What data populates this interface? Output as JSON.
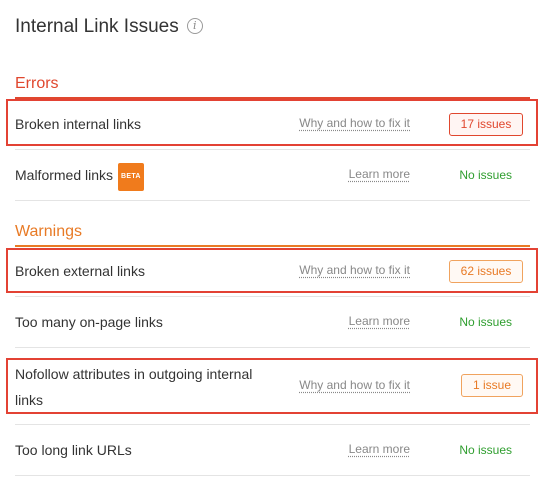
{
  "page": {
    "title": "Internal Link Issues"
  },
  "colors": {
    "error": "#e0472e",
    "warning": "#e87a25",
    "ok": "#2f9e2f",
    "highlight": "#e34234"
  },
  "errors": {
    "heading": "Errors",
    "rows": [
      {
        "label": "Broken internal links",
        "link": "Why and how to fix it",
        "badge": "17 issues"
      },
      {
        "label": "Malformed links",
        "tag": "BETA",
        "link": "Learn more",
        "status": "No issues"
      }
    ]
  },
  "warnings": {
    "heading": "Warnings",
    "rows": [
      {
        "label": "Broken external links",
        "link": "Why and how to fix it",
        "badge": "62 issues"
      },
      {
        "label": "Too many on-page links",
        "link": "Learn more",
        "status": "No issues"
      },
      {
        "label_line1": "Nofollow attributes in outgoing internal",
        "label_line2": "links",
        "link": "Why and how to fix it",
        "badge": "1 issue"
      },
      {
        "label": "Too long link URLs",
        "link": "Learn more",
        "status": "No issues"
      }
    ]
  }
}
